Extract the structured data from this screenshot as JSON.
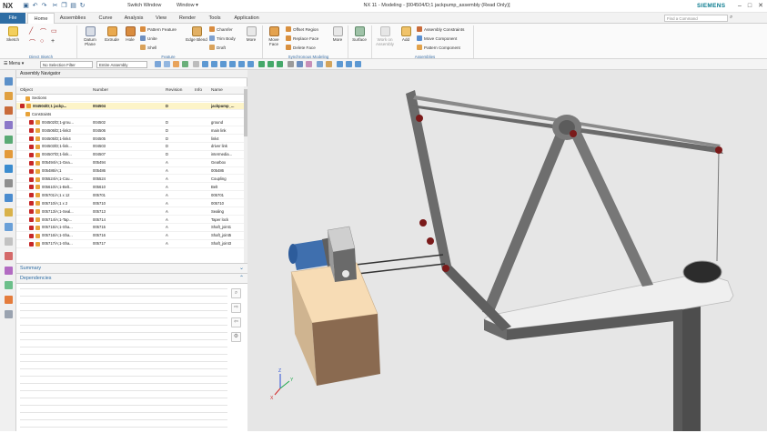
{
  "app": {
    "logo": "NX",
    "quick_access": [
      "save",
      "undo",
      "redo",
      "cut",
      "copy",
      "paste",
      "repeat"
    ],
    "switch_window": "Switch Window",
    "window_menu": "Window",
    "title": "NX 11 - Modeling - [004504/D;1 jackpump_assembly (Read Only)]",
    "brand": "SIEMENS"
  },
  "tabs": [
    {
      "label": "File"
    },
    {
      "label": "Home"
    },
    {
      "label": "Assemblies"
    },
    {
      "label": "Curve"
    },
    {
      "label": "Analysis"
    },
    {
      "label": "View"
    },
    {
      "label": "Render"
    },
    {
      "label": "Tools"
    },
    {
      "label": "Application"
    }
  ],
  "search": {
    "placeholder": "Find a Command"
  },
  "ribbon": {
    "sketch": "Sketch",
    "datum_plane": "Datum Plane",
    "extrude": "Extrude",
    "hole": "Hole",
    "pattern_feature": "Pattern Feature",
    "unite": "Unite",
    "shell": "Shell",
    "edge_blend": "Edge Blend",
    "chamfer": "Chamfer",
    "trim_body": "Trim Body",
    "draft": "Draft",
    "more1": "More",
    "move_face": "Move Face",
    "offset_region": "Offset Region",
    "replace_face": "Replace Face",
    "delete_face": "Delete Face",
    "more2": "More",
    "surface": "Surface",
    "work_on_assembly": "Work on Assembly",
    "add": "Add",
    "assembly_constraints": "Assembly Constraints",
    "move_component": "Move Component",
    "pattern_component": "Pattern Component",
    "groups": {
      "direct_sketch": "Direct Sketch",
      "feature": "Feature",
      "synchronous": "Synchronous Modeling",
      "assemblies": "Assemblies"
    }
  },
  "toolbar2": {
    "menu": "Menu",
    "selection_filter": "No Selection Filter",
    "scope": "Entire Assembly"
  },
  "navigator": {
    "title": "Assembly Navigator",
    "columns": [
      "Object",
      "Number",
      "Revision",
      "Info",
      "Name"
    ],
    "rows": [
      {
        "object": "Sections",
        "number": "",
        "revision": "",
        "name": ""
      },
      {
        "object": "004504/D;1 jackp...",
        "number": "004504",
        "revision": "D",
        "name": "jackpump_..."
      },
      {
        "object": "Constraints",
        "number": "",
        "revision": "",
        "name": ""
      },
      {
        "object": "004502/D;1-grou...",
        "number": "004502",
        "revision": "D",
        "name": "ground"
      },
      {
        "object": "004506/D;1-link3",
        "number": "004506",
        "revision": "D",
        "name": "main link"
      },
      {
        "object": "004505/D;1-link4",
        "number": "004505",
        "revision": "D",
        "name": "link4"
      },
      {
        "object": "004503/D;1-link...",
        "number": "004503",
        "revision": "D",
        "name": "driver link"
      },
      {
        "object": "004507/D;1-link...",
        "number": "004507",
        "revision": "D",
        "name": "intermedia..."
      },
      {
        "object": "005494/A;1-Gea...",
        "number": "005494",
        "revision": "A",
        "name": "Gearbox"
      },
      {
        "object": "005486/A;1",
        "number": "005486",
        "revision": "A",
        "name": "005486"
      },
      {
        "object": "005524/A;1-Cou...",
        "number": "005524",
        "revision": "A",
        "name": "Coupling"
      },
      {
        "object": "005610/A;1-Belt...",
        "number": "005610",
        "revision": "A",
        "name": "Belt"
      },
      {
        "object": "005701/A;1 x 12",
        "number": "005701",
        "revision": "A",
        "name": "005701"
      },
      {
        "object": "005710/A;1 x 2",
        "number": "005710",
        "revision": "A",
        "name": "005710"
      },
      {
        "object": "005713/A;1-Seal...",
        "number": "005713",
        "revision": "A",
        "name": "Sealing"
      },
      {
        "object": "005714/A;1-Tap...",
        "number": "005714",
        "revision": "A",
        "name": "Taper lock"
      },
      {
        "object": "005715/A;1-Sha...",
        "number": "005715",
        "revision": "A",
        "name": "Shaft_joint1"
      },
      {
        "object": "005716/A;1-Sha...",
        "number": "005716",
        "revision": "A",
        "name": "Shaft_joint5"
      },
      {
        "object": "005717/A;1-Sha...",
        "number": "005717",
        "revision": "A",
        "name": "Shaft_joint3"
      }
    ]
  },
  "summary": {
    "title": "Summary"
  },
  "dependencies": {
    "title": "Dependencies"
  },
  "viewport": {
    "background": "#e6e6e6",
    "triad_labels": [
      "Z",
      "Y",
      "X"
    ]
  }
}
